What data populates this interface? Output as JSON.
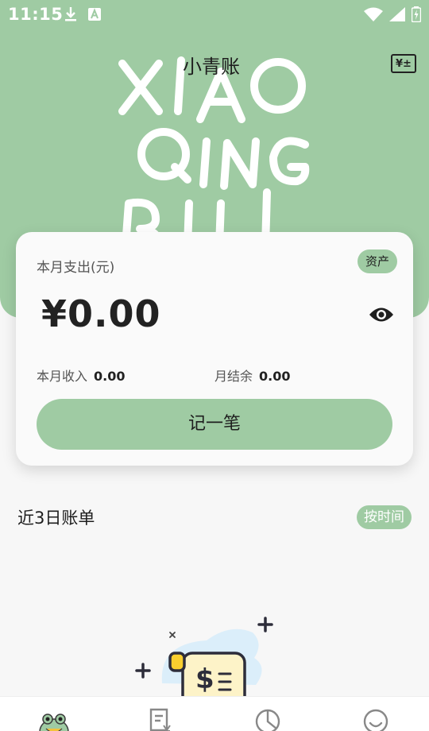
{
  "status_bar": {
    "time": "11:15"
  },
  "header": {
    "title": "小青账",
    "wallet_icon": "wallet-icon",
    "deco_lines": [
      "XIAO",
      "QING",
      "BU"
    ],
    "bg_color": "#9fcba3"
  },
  "summary_card": {
    "label": "本月支出(元)",
    "asset_tag": "资产",
    "amount": "¥0.00",
    "income_label": "本月收入",
    "income_value": "0.00",
    "balance_label": "月结余",
    "balance_value": "0.00",
    "record_button": "记一笔"
  },
  "recent": {
    "title": "近3日账单",
    "sort_button": "按时间"
  },
  "bottom_nav": {
    "items": [
      {
        "icon": "frog-avatar-icon"
      },
      {
        "icon": "bill-icon"
      },
      {
        "icon": "pie-chart-icon"
      },
      {
        "icon": "smile-icon"
      }
    ]
  }
}
